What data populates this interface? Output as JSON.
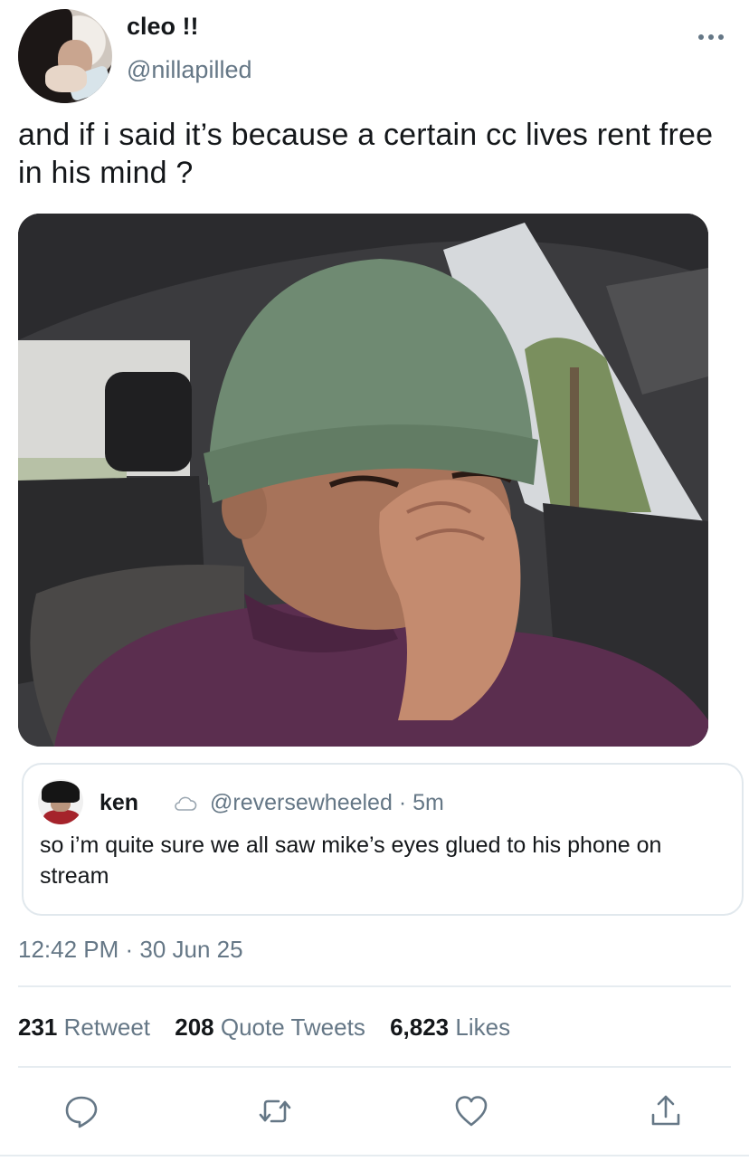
{
  "author": {
    "display_name": "cleo !!",
    "handle": "@nillapilled"
  },
  "tweet": {
    "text": "and if i said it’s because a certain cc lives rent free in his mind ?",
    "timestamp": "12:42 PM · 30 Jun 25"
  },
  "quoted": {
    "name": "ken",
    "handle_time": "@reversewheeled · 5m",
    "text": "so i’m quite sure we all saw mike’s eyes glued to his phone on stream"
  },
  "stats": {
    "retweets": "231",
    "retweets_label": "Retweet",
    "quotes": "208",
    "quotes_label": "Quote Tweets",
    "likes": "6,823",
    "likes_label": "Likes"
  },
  "icons": {
    "more": "more-dots-icon",
    "reply": "reply-icon",
    "retweet": "retweet-icon",
    "like": "heart-icon",
    "share": "share-icon",
    "badge": "cloud-icon"
  },
  "colors": {
    "secondary_text": "#657786",
    "primary_text": "#14171a",
    "border": "#e1e8ed"
  }
}
